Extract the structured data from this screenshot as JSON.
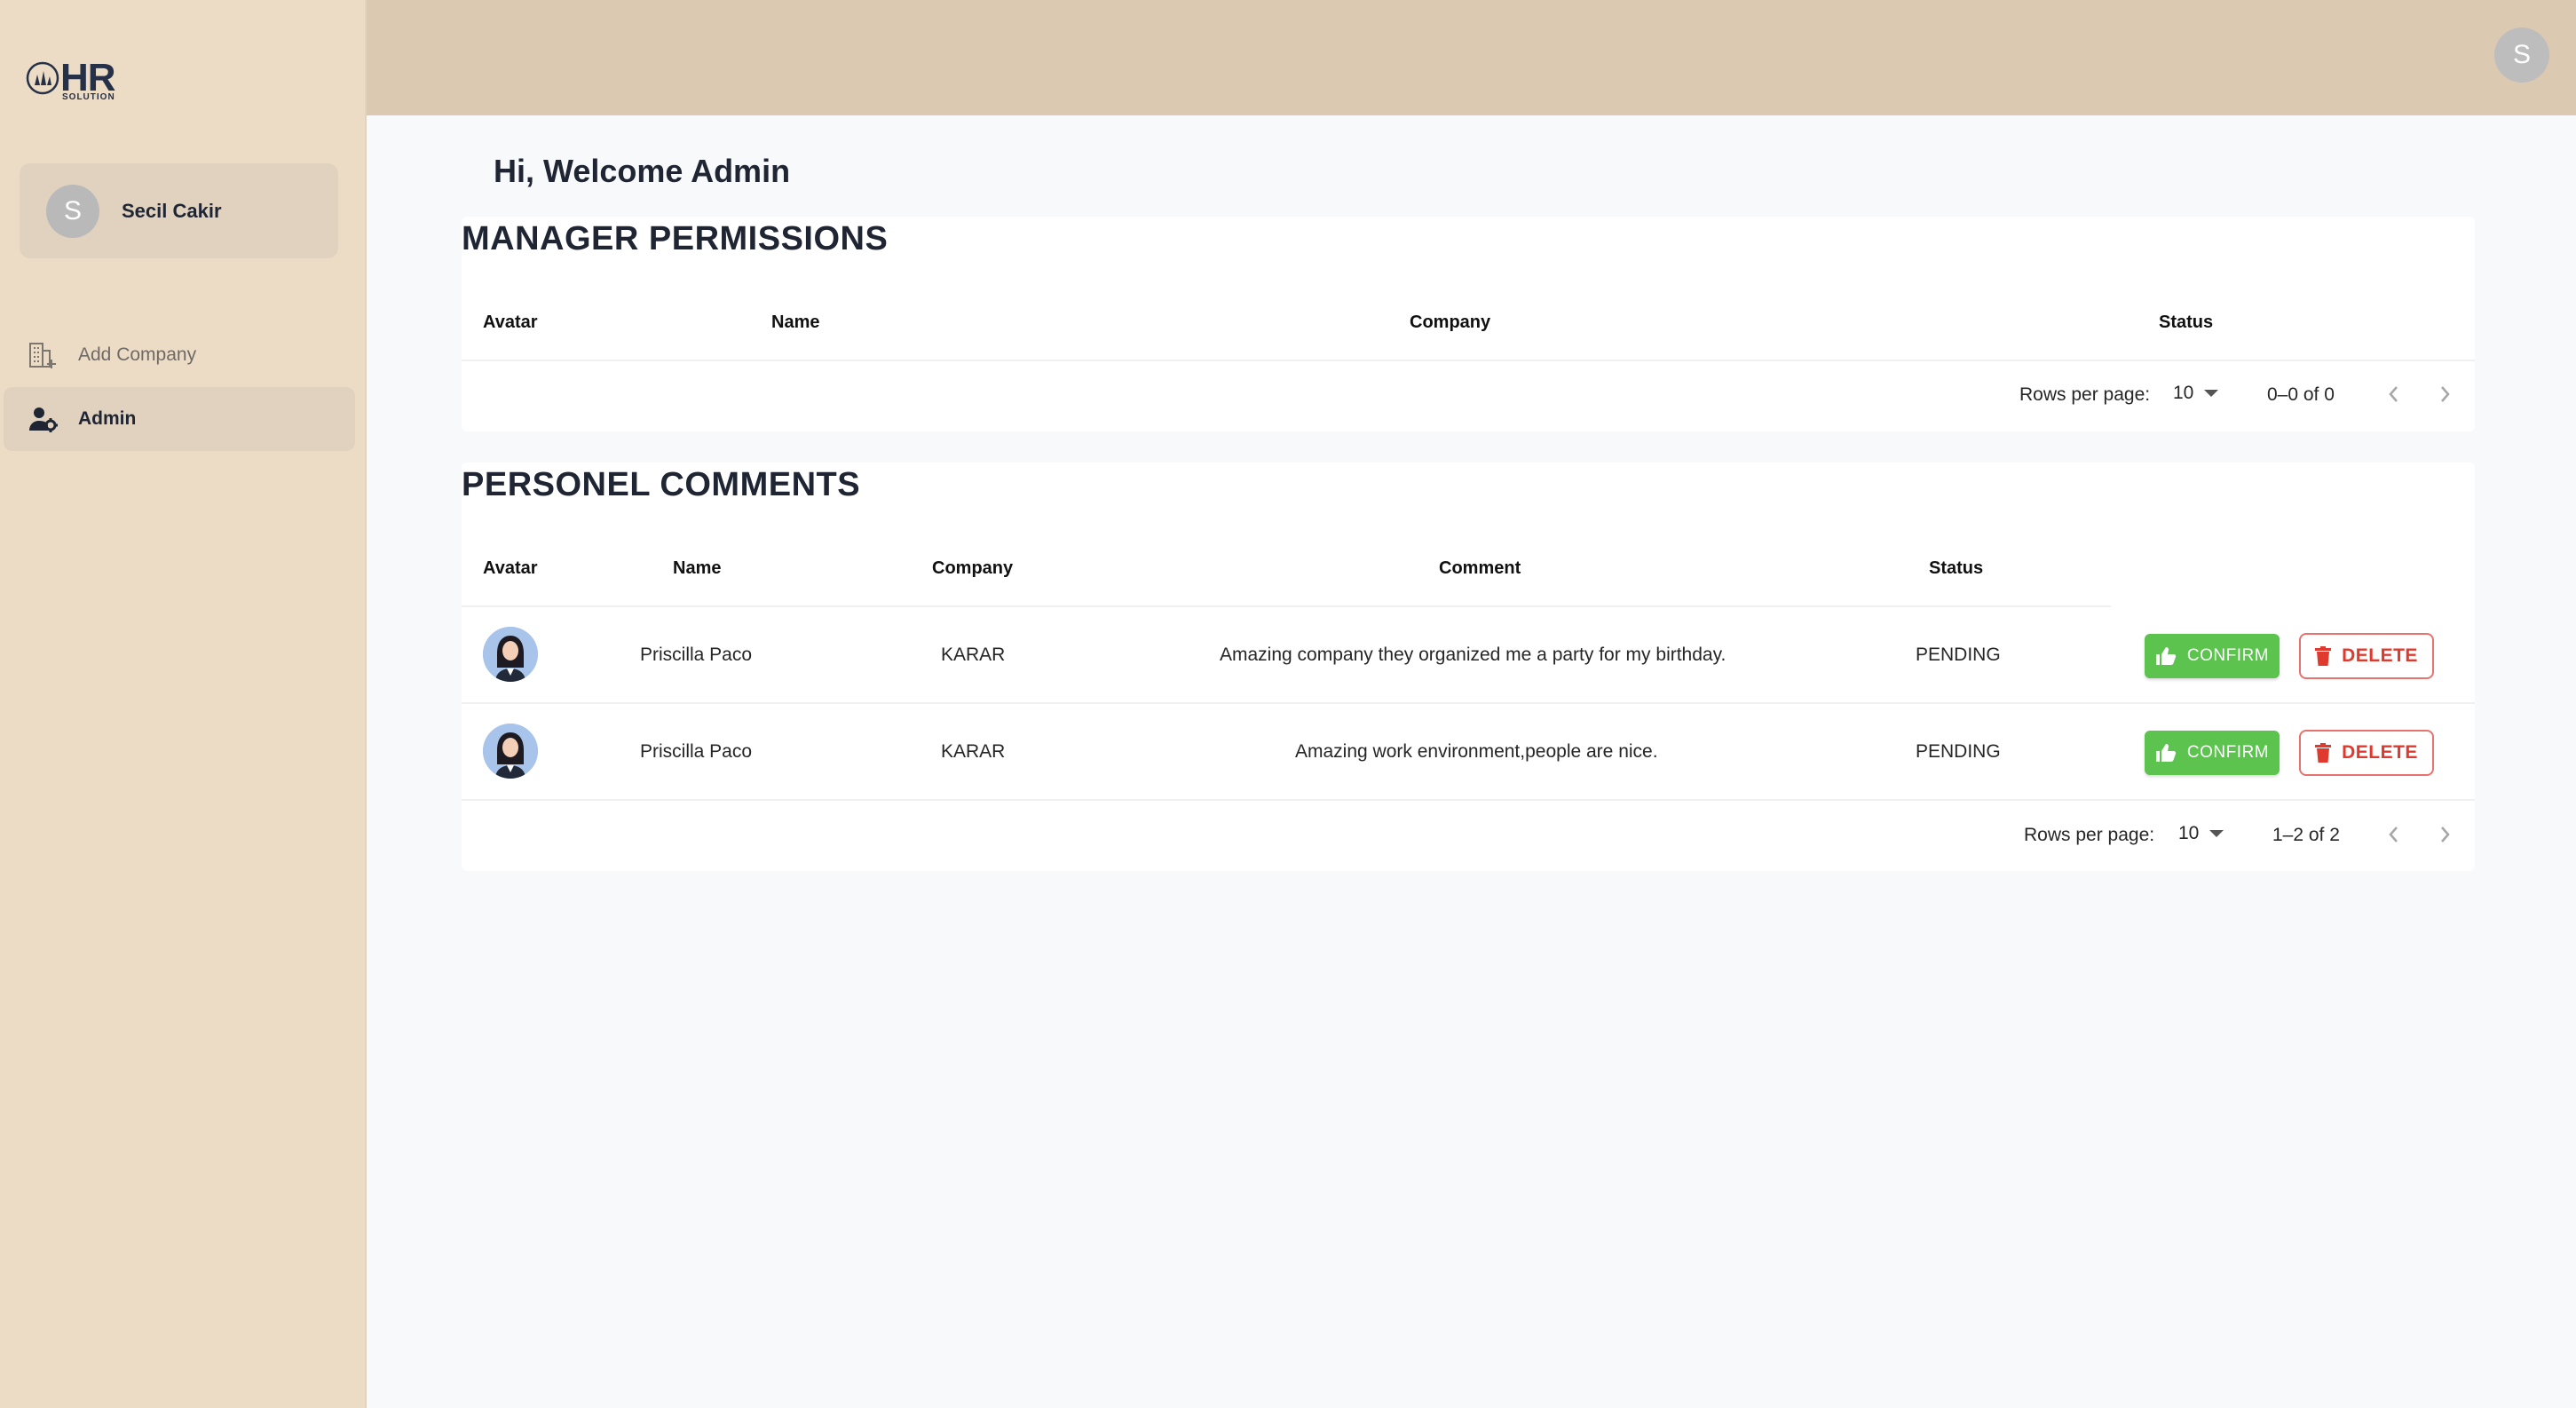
{
  "brand": {
    "logo_text": "HR",
    "logo_sub": "SOLUTION"
  },
  "user": {
    "initial": "S",
    "name": "Secil Cakir"
  },
  "sidebar": {
    "items": [
      {
        "label": "Add Company",
        "icon": "building-add-icon",
        "active": false
      },
      {
        "label": "Admin",
        "icon": "users-gear-icon",
        "active": true
      }
    ]
  },
  "header": {
    "avatar_initial": "S"
  },
  "main": {
    "welcome": "Hi, Welcome Admin",
    "manager_permissions": {
      "title": "MANAGER PERMISSIONS",
      "columns": [
        "Avatar",
        "Name",
        "Company",
        "Status"
      ],
      "rows": [],
      "pagination": {
        "rows_per_page_label": "Rows per page:",
        "rows_per_page": "10",
        "range": "0–0 of 0"
      }
    },
    "personel_comments": {
      "title": "PERSONEL COMMENTS",
      "columns": [
        "Avatar",
        "Name",
        "Company",
        "Comment",
        "Status"
      ],
      "rows": [
        {
          "name": "Priscilla Paco",
          "company": "KARAR",
          "comment": "Amazing company they organized me a party for my birthday.",
          "status": "PENDING",
          "confirm_label": "CONFIRM",
          "delete_label": "DELETE"
        },
        {
          "name": "Priscilla Paco",
          "company": "KARAR",
          "comment": "Amazing work environment,people are nice.",
          "status": "PENDING",
          "confirm_label": "CONFIRM",
          "delete_label": "DELETE"
        }
      ],
      "pagination": {
        "rows_per_page_label": "Rows per page:",
        "rows_per_page": "10",
        "range": "1–2 of 2"
      }
    }
  },
  "colors": {
    "sidebar_bg": "#ecdcc6",
    "topbar_bg": "#dbc9b2",
    "confirm": "#5cc34e",
    "delete": "#e03a2f"
  }
}
